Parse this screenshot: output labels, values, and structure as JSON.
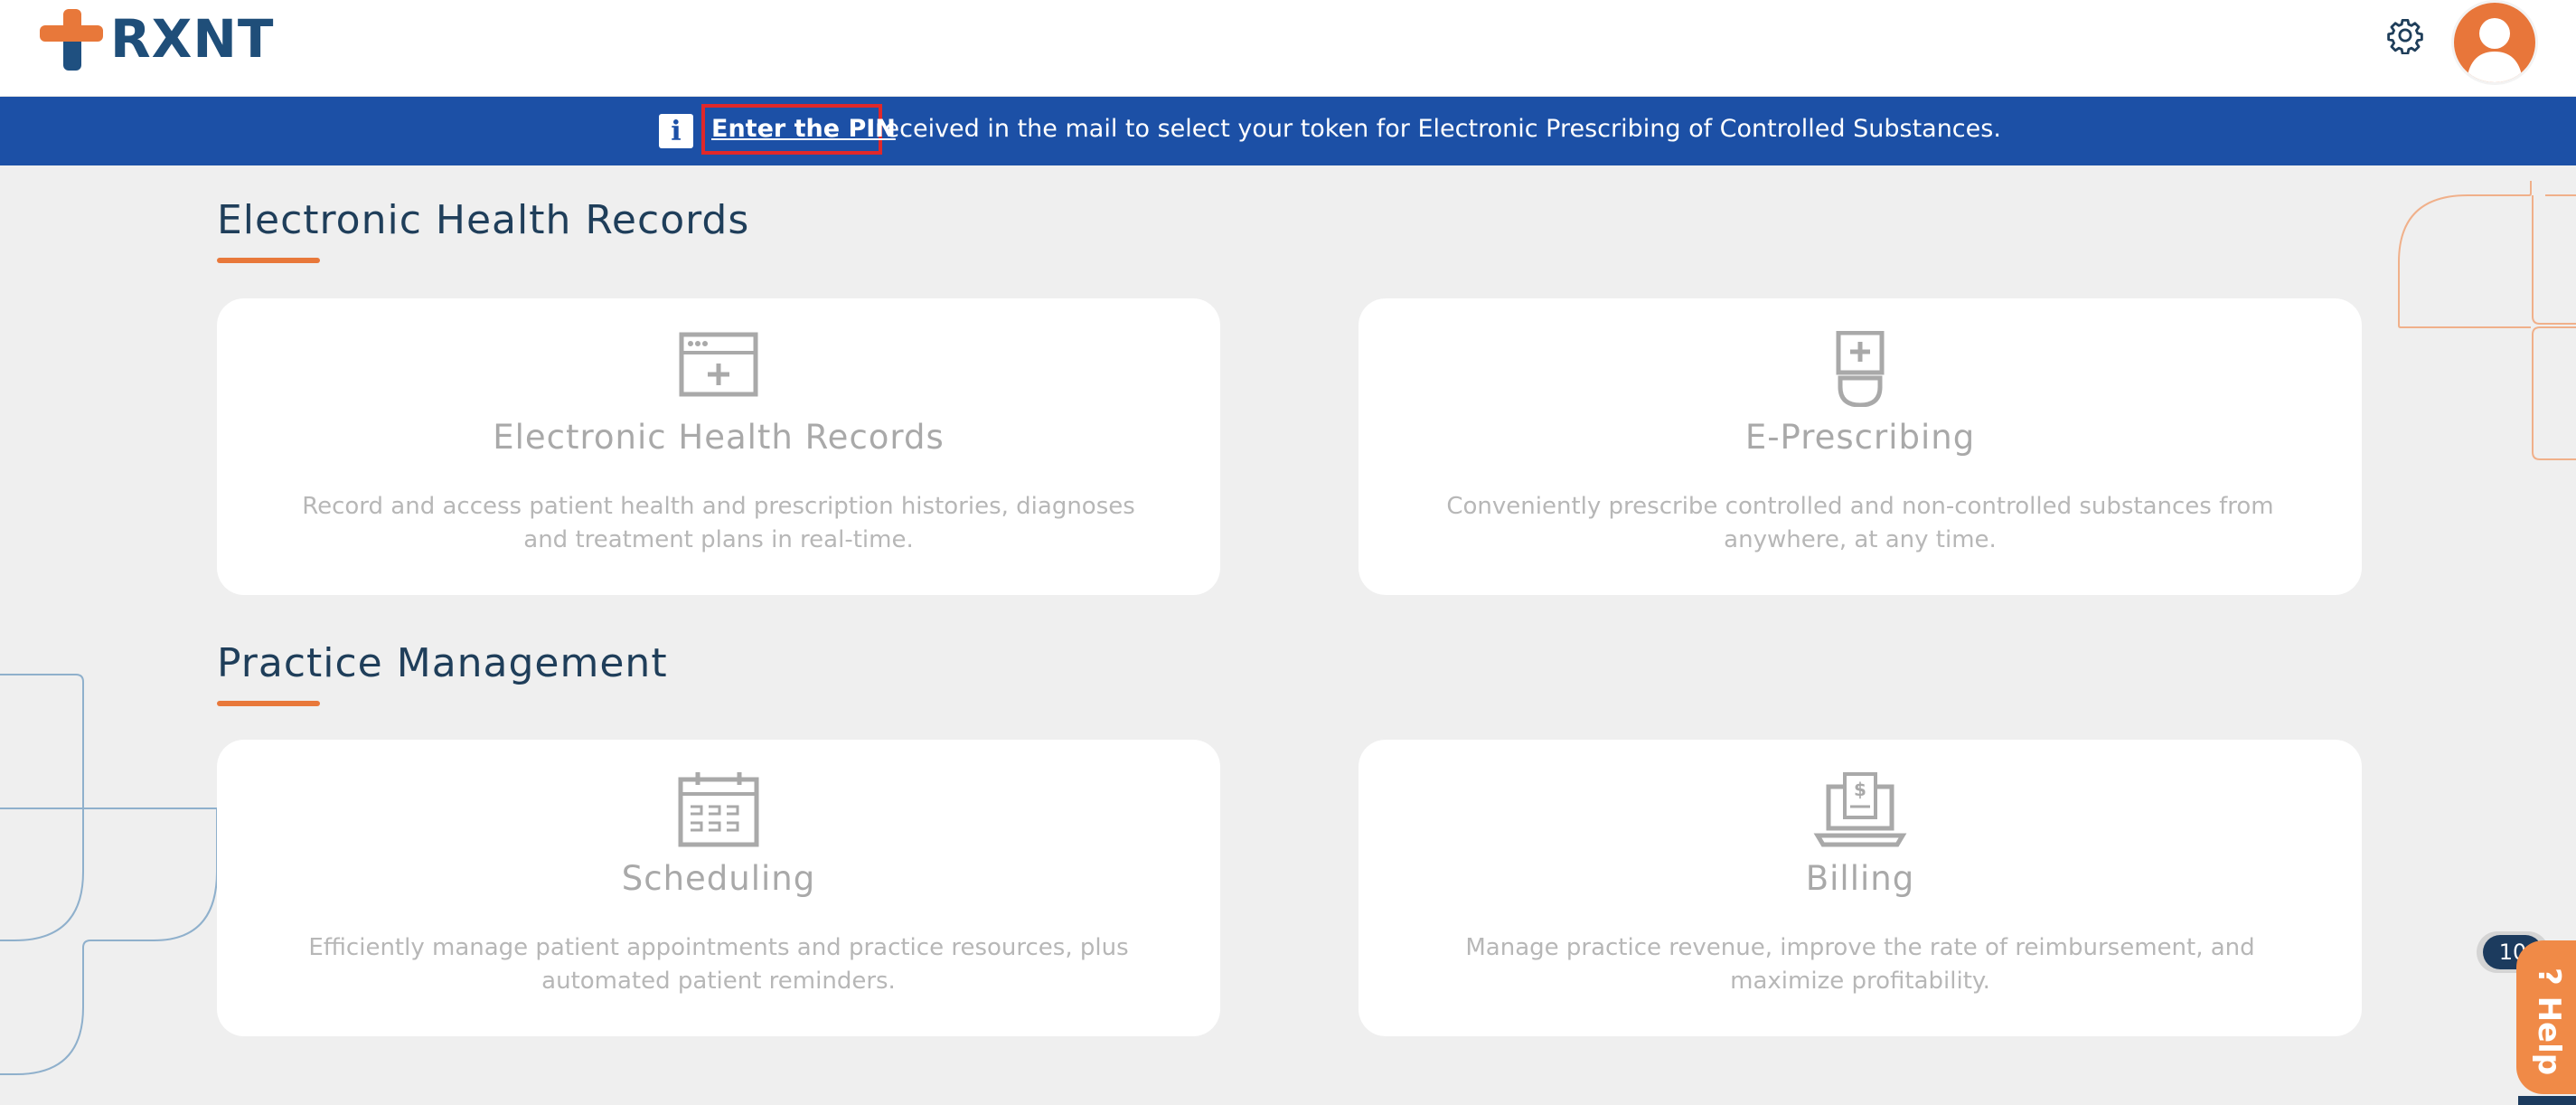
{
  "header": {
    "logo_text": "RXNT",
    "icons": {
      "settings": "gear-icon",
      "profile": "user-avatar"
    }
  },
  "banner": {
    "link_text": "Enter the PIN",
    "message": "received in the mail to select your token for Electronic Prescribing of Controlled Substances.",
    "icon": "info-icon"
  },
  "sections": [
    {
      "title": "Electronic Health Records",
      "cards": [
        {
          "title": "Electronic Health Records",
          "description_line1": "Record and access patient health and prescription histories, diagnoses",
          "description_line2": "and treatment plans in real-time.",
          "icon": "ehr-window-icon"
        },
        {
          "title": "E-Prescribing",
          "description_line1": "Conveniently prescribe controlled and non-controlled substances from",
          "description_line2": "anywhere, at any time.",
          "icon": "prescription-bottle-icon"
        }
      ]
    },
    {
      "title": "Practice Management",
      "cards": [
        {
          "title": "Scheduling",
          "description_line1": "Efficiently manage patient appointments and practice resources, plus",
          "description_line2": "automated patient reminders.",
          "icon": "calendar-icon"
        },
        {
          "title": "Billing",
          "description_line1": "Manage practice revenue, improve the rate of reimbursement, and",
          "description_line2": "maximize profitability.",
          "icon": "billing-laptop-icon"
        }
      ]
    }
  ],
  "help": {
    "count": "10",
    "label": "Help",
    "icon": "question-icon"
  },
  "colors": {
    "brand_blue": "#1c50a6",
    "accent_orange": "#e8783a",
    "heading": "#1f3e5a"
  }
}
